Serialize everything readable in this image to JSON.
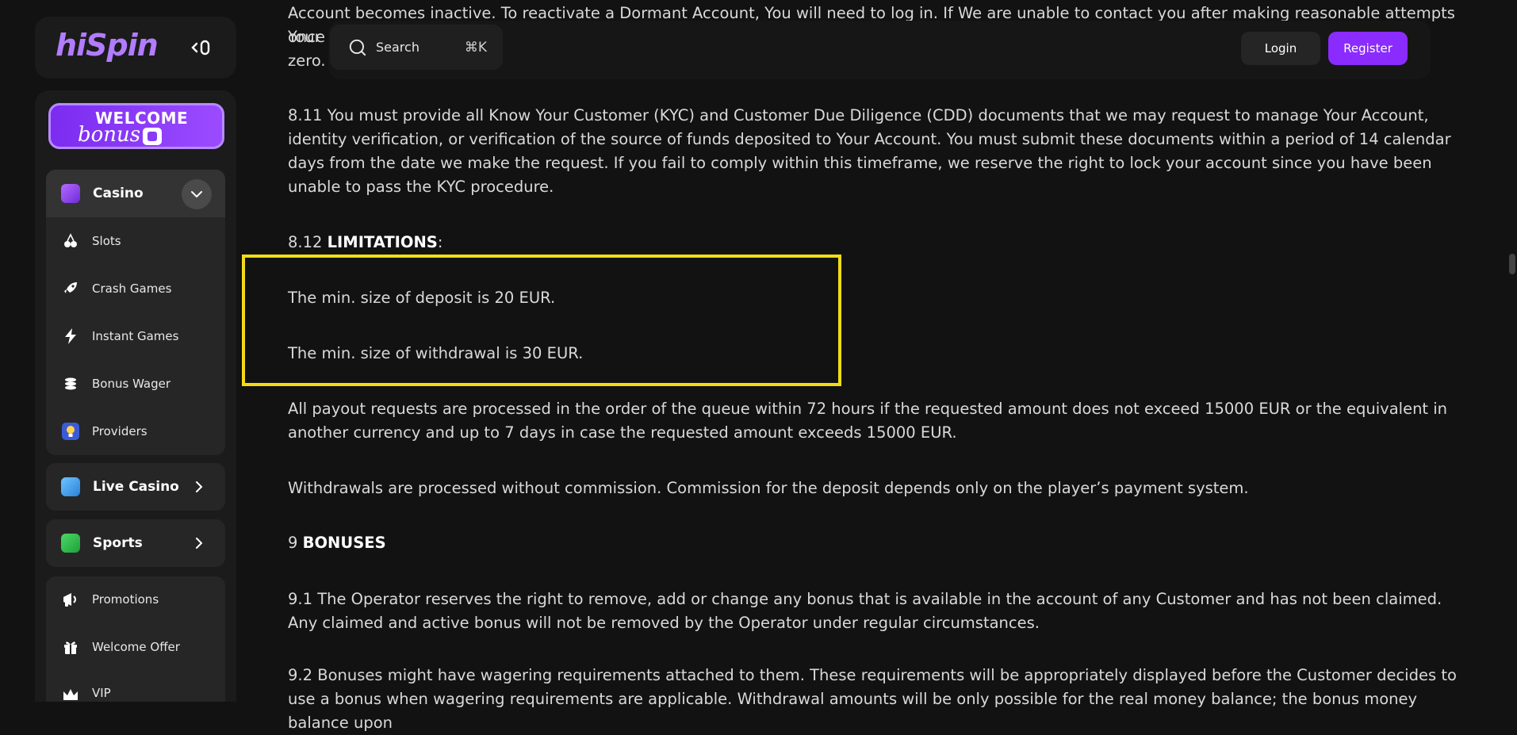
{
  "header": {
    "logo": "hiSpin",
    "search_label": "Search",
    "search_shortcut": "⌘K",
    "login_label": "Login",
    "register_label": "Register"
  },
  "sidebar": {
    "welcome_title": "WELCOME",
    "welcome_sub": "bonus",
    "casino_label": "Casino",
    "casino_items": [
      {
        "label": "Slots",
        "icon": "cherries-icon"
      },
      {
        "label": "Crash Games",
        "icon": "rocket-icon"
      },
      {
        "label": "Instant Games",
        "icon": "lightning-icon"
      },
      {
        "label": "Bonus Wager",
        "icon": "coins-icon"
      },
      {
        "label": "Providers",
        "icon": "lightbulb-icon"
      }
    ],
    "live_casino_label": "Live Casino",
    "sports_label": "Sports",
    "extra_items": [
      {
        "label": "Promotions",
        "icon": "megaphone-icon"
      },
      {
        "label": "Welcome Offer",
        "icon": "gift-icon"
      },
      {
        "label": "VIP",
        "icon": "crown-icon"
      }
    ]
  },
  "document": {
    "p_top_1": "Account becomes inactive. To reactivate a Dormant Account, You will need to log in. If We are unable to contact you after making reasonable attempts once",
    "p_top_2": "Your",
    "p_top_3": "zero.",
    "p_811": "8.11 You must provide all Know Your Customer (KYC) and Customer Due Diligence (CDD) documents that we may request to manage Your Account, identity verification, or verification of the source of funds deposited to Your Account. You must submit these documents within a period of 14 calendar days from the date we make the request. If you fail to comply within this timeframe, we reserve the right to lock your account since you have been unable to pass the KYC procedure.",
    "p_812_num": "8.12 ",
    "p_812_title": "LIMITATIONS",
    "p_812_colon": ":",
    "p_min_deposit": "The min. size of deposit is 20 EUR.",
    "p_min_withdrawal": "The min. size of withdrawal is 30 EUR.",
    "p_payout": "All payout requests are processed in the order of the queue within 72 hours if the requested amount does not exceed 15000 EUR or the equivalent in another currency and up to 7 days in case the requested amount exceeds 15000 EUR.",
    "p_withdrawals": "Withdrawals are processed without commission. Commission for the deposit depends only on the player’s payment system.",
    "p_9_num": "9 ",
    "p_9_title": "BONUSES",
    "p_91": "9.1 The Operator reserves the right to remove, add or change any bonus that is available in the account of any Customer and has not been claimed. Any claimed and active bonus will not be removed by the Operator under regular circumstances.",
    "p_92": "9.2 Bonuses might have wagering requirements attached to them. These requirements will be appropriately displayed before the Customer decides to use a bonus when wagering requirements are applicable. Withdrawal amounts will be only possible for the real money balance; the bonus money balance upon"
  },
  "colors": {
    "accent": "#8a2bff",
    "highlight": "#f2dc16",
    "background": "#121212"
  }
}
